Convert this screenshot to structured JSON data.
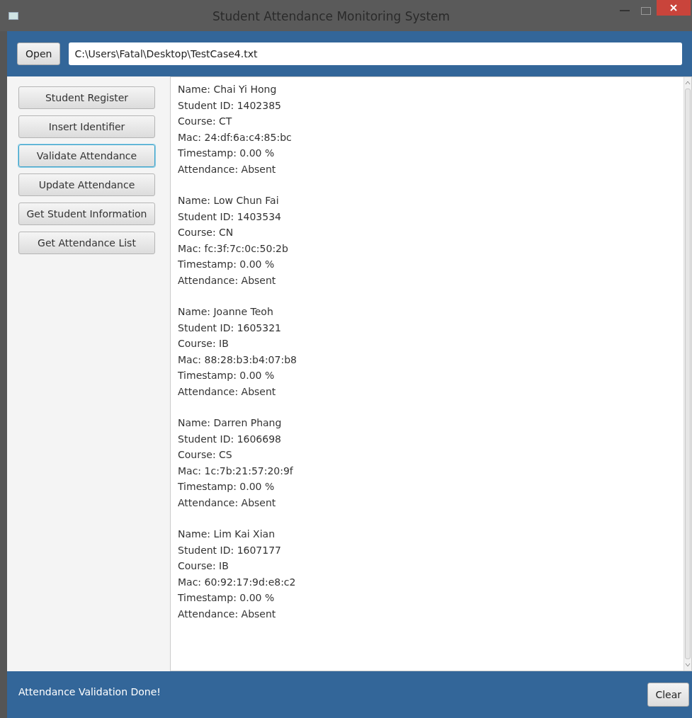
{
  "window": {
    "title": "Student Attendance Monitoring System"
  },
  "toolbar": {
    "open_button": "Open",
    "path_field": {
      "value": "C:\\Users\\Fatal\\Desktop\\TestCase4.txt"
    }
  },
  "sidebar": {
    "buttons": [
      {
        "label": "Student Register",
        "focused": false
      },
      {
        "label": "Insert Identifier",
        "focused": false
      },
      {
        "label": "Validate Attendance",
        "focused": true
      },
      {
        "label": "Update Attendance",
        "focused": false
      },
      {
        "label": "Get Student Information",
        "focused": false
      },
      {
        "label": "Get Attendance List",
        "focused": false
      }
    ]
  },
  "output": {
    "records": [
      {
        "lines": [
          "Name: Chai Yi Hong",
          "Student ID: 1402385",
          "Course: CT",
          "Mac: 24:df:6a:c4:85:bc",
          "Timestamp: 0.00 %",
          "Attendance: Absent"
        ]
      },
      {
        "lines": [
          "Name: Low Chun Fai",
          "Student ID: 1403534",
          "Course: CN",
          "Mac: fc:3f:7c:0c:50:2b",
          "Timestamp: 0.00 %",
          "Attendance: Absent"
        ]
      },
      {
        "lines": [
          "Name: Joanne Teoh",
          "Student ID: 1605321",
          "Course: IB",
          "Mac: 88:28:b3:b4:07:b8",
          "Timestamp: 0.00 %",
          "Attendance: Absent"
        ]
      },
      {
        "lines": [
          "Name: Darren Phang",
          "Student ID: 1606698",
          "Course: CS",
          "Mac: 1c:7b:21:57:20:9f",
          "Timestamp: 0.00 %",
          "Attendance: Absent"
        ]
      },
      {
        "lines": [
          "Name: Lim Kai Xian",
          "Student ID: 1607177",
          "Course: IB",
          "Mac: 60:92:17:9d:e8:c2",
          "Timestamp: 0.00 %",
          "Attendance: Absent"
        ]
      }
    ]
  },
  "status_bar": {
    "message": "Attendance Validation Done!",
    "clear_button": "Clear"
  }
}
